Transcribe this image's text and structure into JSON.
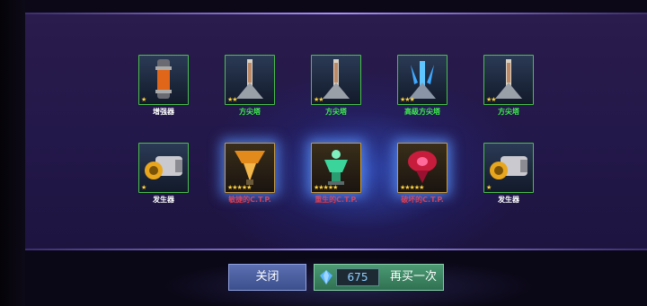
{
  "rewards": [
    {
      "name": "增强器",
      "stars": "★",
      "label_color": "#ffffff",
      "frame": "green",
      "art": "booster-icon"
    },
    {
      "name": "方尖塔",
      "stars": "★★",
      "label_color": "#3cf04a",
      "frame": "green",
      "art": "obelisk-icon"
    },
    {
      "name": "方尖塔",
      "stars": "★★",
      "label_color": "#3cf04a",
      "frame": "green",
      "art": "obelisk-icon"
    },
    {
      "name": "高级方尖塔",
      "stars": "★★★",
      "label_color": "#3cf04a",
      "frame": "green",
      "art": "advanced-obelisk-icon"
    },
    {
      "name": "方尖塔",
      "stars": "★★",
      "label_color": "#3cf04a",
      "frame": "green",
      "art": "obelisk-icon"
    },
    {
      "name": "发生器",
      "stars": "★",
      "label_color": "#ffffff",
      "frame": "green",
      "art": "generator-icon"
    },
    {
      "name": "敏捷的C.T.P.",
      "stars": "★★★★★",
      "label_color": "#ff2a2a",
      "frame": "gold",
      "art": "ctp-orange-icon"
    },
    {
      "name": "重生的C.T.P.",
      "stars": "★★★★★",
      "label_color": "#ff2a2a",
      "frame": "gold",
      "art": "ctp-green-icon"
    },
    {
      "name": "破坏的C.T.P.",
      "stars": "★★★★★",
      "label_color": "#ff2a2a",
      "frame": "gold",
      "art": "ctp-red-icon"
    },
    {
      "name": "发生器",
      "stars": "★",
      "label_color": "#ffffff",
      "frame": "green",
      "art": "generator-icon"
    }
  ],
  "buttons": {
    "close_label": "关闭",
    "buy_again_label": "再买一次",
    "cost": "675",
    "currency_icon": "blue-crystal-icon"
  }
}
